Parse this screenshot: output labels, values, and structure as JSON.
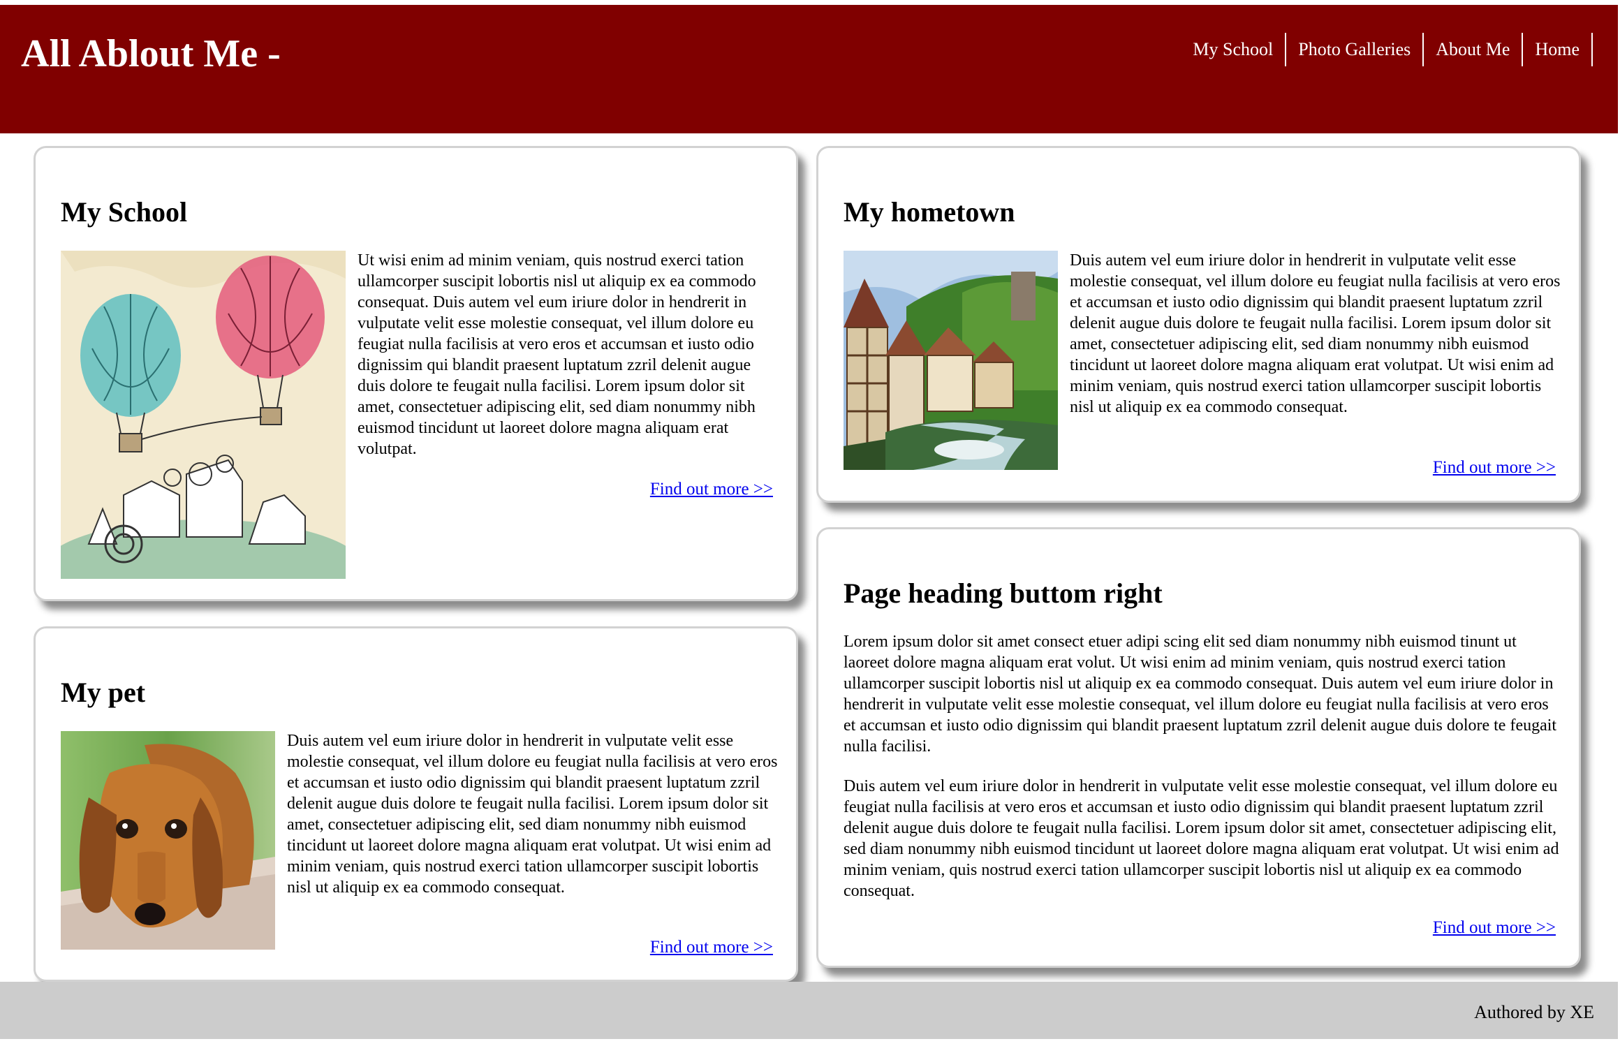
{
  "header": {
    "title": "All Ablout Me -",
    "background": "#800000",
    "nav": [
      {
        "label": "My School"
      },
      {
        "label": "Photo Galleries"
      },
      {
        "label": "About Me"
      },
      {
        "label": "Home"
      }
    ]
  },
  "cards": {
    "school": {
      "title": "My School",
      "image": "hot-air-balloons-illustration",
      "body": "Ut wisi enim ad minim veniam, quis nostrud exerci tation ullamcorper suscipit lobortis nisl ut aliquip ex ea commodo consequat. Duis autem vel eum iriure dolor in hendrerit in vulputate velit esse molestie consequat, vel illum dolore eu feugiat nulla facilisis at vero eros et accumsan et iusto odio dignissim qui blandit praesent luptatum zzril delenit augue duis dolore te feugait nulla facilisi. Lorem ipsum dolor sit amet, consectetuer adipiscing elit, sed diam nonummy nibh euismod tincidunt ut laoreet dolore magna aliquam erat volutpat.",
      "link": "Find out more >>"
    },
    "hometown": {
      "title": "My hometown",
      "image": "village-river-photo",
      "body": "Duis autem vel eum iriure dolor in hendrerit in vulputate velit esse molestie consequat, vel illum dolore eu feugiat nulla facilisis at vero eros et accumsan et iusto odio dignissim qui blandit praesent luptatum zzril delenit augue duis dolore te feugait nulla facilisi. Lorem ipsum dolor sit amet, consectetuer adipiscing elit, sed diam nonummy nibh euismod tincidunt ut laoreet dolore magna aliquam erat volutpat. Ut wisi enim ad minim veniam, quis nostrud exerci tation ullamcorper suscipit lobortis nisl ut aliquip ex ea commodo consequat.",
      "link": "Find out more >>"
    },
    "pet": {
      "title": "My pet",
      "image": "dachshund-photo",
      "body": "Duis autem vel eum iriure dolor in hendrerit in vulputate velit esse molestie consequat, vel illum dolore eu feugiat nulla facilisis at vero eros et accumsan et iusto odio dignissim qui blandit praesent luptatum zzril delenit augue duis dolore te feugait nulla facilisi. Lorem ipsum dolor sit amet, consectetuer adipiscing elit, sed diam nonummy nibh euismod tincidunt ut laoreet dolore magna aliquam erat volutpat. Ut wisi enim ad minim veniam, quis nostrud exerci tation ullamcorper suscipit lobortis nisl ut aliquip ex ea commodo consequat.",
      "link": "Find out more >>"
    },
    "bottom_right": {
      "title": "Page heading buttom right",
      "para1": "Lorem ipsum dolor sit amet consect etuer adipi scing elit sed diam nonummy nibh euismod tinunt ut laoreet dolore magna aliquam erat volut. Ut wisi enim ad minim veniam, quis nostrud exerci tation ullamcorper suscipit lobortis nisl ut aliquip ex ea commodo consequat. Duis autem vel eum iriure dolor in hendrerit in vulputate velit esse molestie consequat, vel illum dolore eu feugiat nulla facilisis at vero eros et accumsan et iusto odio dignissim qui blandit praesent luptatum zzril delenit augue duis dolore te feugait nulla facilisi.",
      "para2": "Duis autem vel eum iriure dolor in hendrerit in vulputate velit esse molestie consequat, vel illum dolore eu feugiat nulla facilisis at vero eros et accumsan et iusto odio dignissim qui blandit praesent luptatum zzril delenit augue duis dolore te feugait nulla facilisi. Lorem ipsum dolor sit amet, consectetuer adipiscing elit, sed diam nonummy nibh euismod tincidunt ut laoreet dolore magna aliquam erat volutpat. Ut wisi enim ad minim veniam, quis nostrud exerci tation ullamcorper suscipit lobortis nisl ut aliquip ex ea commodo consequat.",
      "link": "Find out more >>"
    }
  },
  "footer": {
    "text": "Authored by XE",
    "background": "#cccccc"
  }
}
